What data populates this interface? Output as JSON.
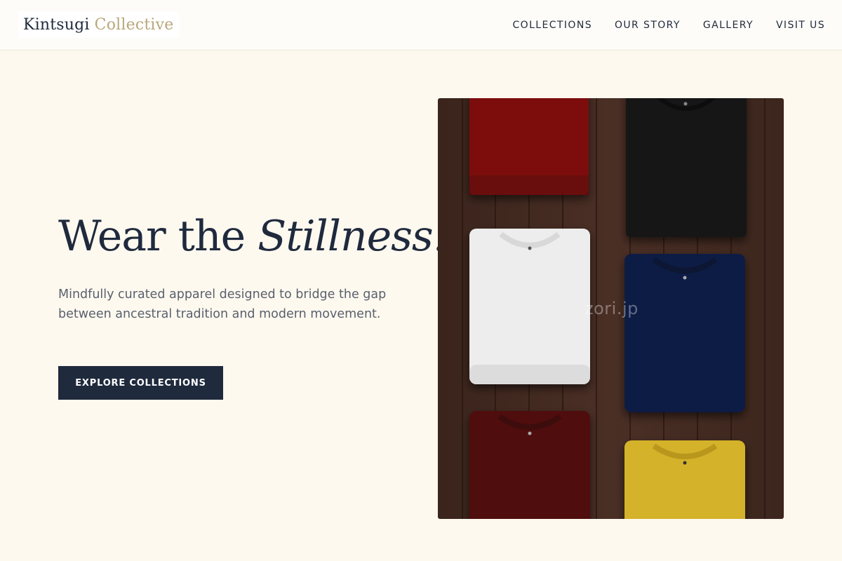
{
  "header": {
    "logo": {
      "word1": "Kintsugi",
      "word2": "Collective"
    },
    "nav": [
      {
        "label": "COLLECTIONS"
      },
      {
        "label": "OUR STORY"
      },
      {
        "label": "GALLERY"
      },
      {
        "label": "VISIT US"
      }
    ]
  },
  "hero": {
    "title_plain": "Wear the ",
    "title_italic": "Stillness.",
    "subtitle": "Mindfully curated apparel designed to bridge the gap between ancestral tradition and modern movement.",
    "cta_label": "EXPLORE COLLECTIONS"
  },
  "image": {
    "watermark": "zori.jp",
    "subject": "folded t-shirts on wooden planks",
    "shirt_colors": [
      "#7d0a0a",
      "#161616",
      "#ededed",
      "#0c1f45",
      "#4f0b10",
      "#d4b22a"
    ]
  },
  "colors": {
    "navy": "#1f2a3d",
    "gold": "#b9a77a",
    "cream": "#fef9ef"
  }
}
